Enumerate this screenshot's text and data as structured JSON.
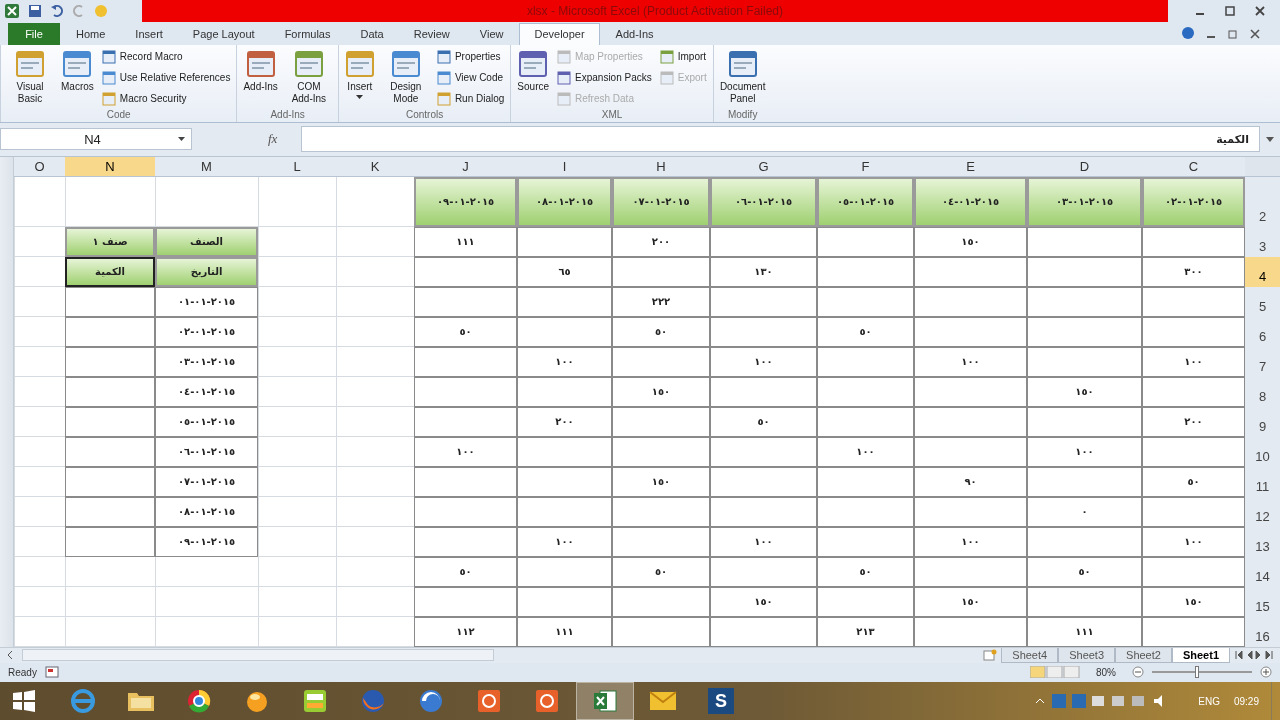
{
  "window": {
    "title": "xlsx - Microsoft Excel (Product Activation Failed)"
  },
  "ribbon_tabs": [
    {
      "label": "Add-Ins",
      "kind": "tab",
      "selected": false
    },
    {
      "label": "Developer",
      "kind": "tab",
      "selected": true
    },
    {
      "label": "View",
      "kind": "tab",
      "selected": false
    },
    {
      "label": "Review",
      "kind": "tab",
      "selected": false
    },
    {
      "label": "Data",
      "kind": "tab",
      "selected": false
    },
    {
      "label": "Formulas",
      "kind": "tab",
      "selected": false
    },
    {
      "label": "Page Layout",
      "kind": "tab",
      "selected": false
    },
    {
      "label": "Insert",
      "kind": "tab",
      "selected": false
    },
    {
      "label": "Home",
      "kind": "tab",
      "selected": false
    },
    {
      "label": "File",
      "kind": "file",
      "selected": false
    }
  ],
  "ribbon_groups": [
    {
      "label": "Modify",
      "columns": [
        {
          "items": [
            {
              "kind": "large",
              "label": "Document Panel",
              "disabled": false
            }
          ]
        }
      ]
    },
    {
      "label": "XML",
      "columns": [
        {
          "items": [
            {
              "kind": "small",
              "label": "Import",
              "disabled": false
            },
            {
              "kind": "small",
              "label": "Export",
              "disabled": true
            }
          ]
        },
        {
          "items": [
            {
              "kind": "small",
              "label": "Map Properties",
              "disabled": true
            },
            {
              "kind": "small",
              "label": "Expansion Packs",
              "disabled": false
            },
            {
              "kind": "small",
              "label": "Refresh Data",
              "disabled": true
            }
          ]
        },
        {
          "items": [
            {
              "kind": "large",
              "label": "Source",
              "disabled": false
            }
          ]
        }
      ]
    },
    {
      "label": "Controls",
      "columns": [
        {
          "items": [
            {
              "kind": "small",
              "label": "Properties",
              "disabled": false
            },
            {
              "kind": "small",
              "label": "View Code",
              "disabled": false
            },
            {
              "kind": "small",
              "label": "Run Dialog",
              "disabled": false
            }
          ]
        },
        {
          "items": [
            {
              "kind": "large",
              "label": "Design Mode",
              "disabled": false
            }
          ]
        },
        {
          "items": [
            {
              "kind": "dropdown",
              "label": "Insert",
              "disabled": false
            }
          ]
        }
      ]
    },
    {
      "label": "Add-Ins",
      "columns": [
        {
          "items": [
            {
              "kind": "large",
              "label": "COM Add-Ins",
              "disabled": false
            }
          ]
        },
        {
          "items": [
            {
              "kind": "large",
              "label": "Add-Ins",
              "disabled": false
            }
          ]
        }
      ]
    },
    {
      "label": "Code",
      "columns": [
        {
          "items": [
            {
              "kind": "small",
              "label": "Record Macro",
              "disabled": false
            },
            {
              "kind": "small",
              "label": "Use Relative References",
              "disabled": false
            },
            {
              "kind": "small",
              "label": "Macro Security",
              "disabled": false
            }
          ]
        },
        {
          "items": [
            {
              "kind": "large",
              "label": "Macros",
              "disabled": false
            }
          ]
        },
        {
          "items": [
            {
              "kind": "large",
              "label": "Visual Basic",
              "disabled": false
            }
          ]
        }
      ]
    }
  ],
  "formula_bar": {
    "name_box": "N4",
    "fx": "fx",
    "value": "الكمية"
  },
  "columns": [
    {
      "letter": "C",
      "selected": false
    },
    {
      "letter": "D",
      "selected": false
    },
    {
      "letter": "E",
      "selected": false
    },
    {
      "letter": "F",
      "selected": false
    },
    {
      "letter": "G",
      "selected": false
    },
    {
      "letter": "H",
      "selected": false
    },
    {
      "letter": "I",
      "selected": false
    },
    {
      "letter": "J",
      "selected": false
    },
    {
      "letter": "K",
      "selected": false
    },
    {
      "letter": "L",
      "selected": false
    },
    {
      "letter": "M",
      "selected": false
    },
    {
      "letter": "N",
      "selected": true
    },
    {
      "letter": "O",
      "selected": false
    }
  ],
  "rows": [
    {
      "number": "2",
      "selected": false,
      "cells": {
        "C": {
          "kind": "header",
          "text": "٢٠١٥-٠١-٠٢",
          "selected": false
        },
        "D": {
          "kind": "header",
          "text": "٢٠١٥-٠١-٠٣",
          "selected": false
        },
        "E": {
          "kind": "header",
          "text": "٢٠١٥-٠١-٠٤",
          "selected": false
        },
        "F": {
          "kind": "header",
          "text": "٢٠١٥-٠١-٠٥",
          "selected": false
        },
        "G": {
          "kind": "header",
          "text": "٢٠١٥-٠١-٠٦",
          "selected": false
        },
        "H": {
          "kind": "header",
          "text": "٢٠١٥-٠١-٠٧",
          "selected": false
        },
        "I": {
          "kind": "header",
          "text": "٢٠١٥-٠١-٠٨",
          "selected": false
        },
        "J": {
          "kind": "header",
          "text": "٢٠١٥-٠١-٠٩",
          "selected": false
        }
      }
    },
    {
      "number": "3",
      "selected": false,
      "cells": {
        "E": {
          "kind": "value",
          "text": "١٥٠",
          "selected": false
        },
        "H": {
          "kind": "value",
          "text": "٢٠٠",
          "selected": false
        },
        "J": {
          "kind": "value",
          "text": "١١١",
          "selected": false
        },
        "M": {
          "kind": "header",
          "text": "الصنف",
          "selected": false
        },
        "N": {
          "kind": "header",
          "text": "صنف ١",
          "selected": false
        }
      }
    },
    {
      "number": "4",
      "selected": true,
      "cells": {
        "C": {
          "kind": "value",
          "text": "٣٠٠",
          "selected": false
        },
        "G": {
          "kind": "value",
          "text": "١٣٠",
          "selected": false
        },
        "I": {
          "kind": "value",
          "text": "٦٥",
          "selected": false
        },
        "M": {
          "kind": "header",
          "text": "التاريخ",
          "selected": false
        },
        "N": {
          "kind": "header",
          "text": "الكمية",
          "selected": true
        }
      }
    },
    {
      "number": "5",
      "selected": false,
      "cells": {
        "H": {
          "kind": "value",
          "text": "٢٢٢",
          "selected": false
        },
        "M": {
          "kind": "value",
          "text": "٢٠١٥-٠١-٠١",
          "selected": false
        }
      }
    },
    {
      "number": "6",
      "selected": false,
      "cells": {
        "F": {
          "kind": "value",
          "text": "٥٠",
          "selected": false
        },
        "H": {
          "kind": "value",
          "text": "٥٠",
          "selected": false
        },
        "J": {
          "kind": "value",
          "text": "٥٠",
          "selected": false
        },
        "M": {
          "kind": "value",
          "text": "٢٠١٥-٠١-٠٢",
          "selected": false
        }
      }
    },
    {
      "number": "7",
      "selected": false,
      "cells": {
        "C": {
          "kind": "value",
          "text": "١٠٠",
          "selected": false
        },
        "E": {
          "kind": "value",
          "text": "١٠٠",
          "selected": false
        },
        "G": {
          "kind": "value",
          "text": "١٠٠",
          "selected": false
        },
        "I": {
          "kind": "value",
          "text": "١٠٠",
          "selected": false
        },
        "M": {
          "kind": "value",
          "text": "٢٠١٥-٠١-٠٣",
          "selected": false
        }
      }
    },
    {
      "number": "8",
      "selected": false,
      "cells": {
        "D": {
          "kind": "value",
          "text": "١٥٠",
          "selected": false
        },
        "H": {
          "kind": "value",
          "text": "١٥٠",
          "selected": false
        },
        "M": {
          "kind": "value",
          "text": "٢٠١٥-٠١-٠٤",
          "selected": false
        }
      }
    },
    {
      "number": "9",
      "selected": false,
      "cells": {
        "C": {
          "kind": "value",
          "text": "٢٠٠",
          "selected": false
        },
        "G": {
          "kind": "value",
          "text": "٥٠",
          "selected": false
        },
        "I": {
          "kind": "value",
          "text": "٢٠٠",
          "selected": false
        },
        "M": {
          "kind": "value",
          "text": "٢٠١٥-٠١-٠٥",
          "selected": false
        }
      }
    },
    {
      "number": "10",
      "selected": false,
      "cells": {
        "D": {
          "kind": "value",
          "text": "١٠٠",
          "selected": false
        },
        "F": {
          "kind": "value",
          "text": "١٠٠",
          "selected": false
        },
        "J": {
          "kind": "value",
          "text": "١٠٠",
          "selected": false
        },
        "M": {
          "kind": "value",
          "text": "٢٠١٥-٠١-٠٦",
          "selected": false
        }
      }
    },
    {
      "number": "11",
      "selected": false,
      "cells": {
        "C": {
          "kind": "value",
          "text": "٥٠",
          "selected": false
        },
        "E": {
          "kind": "value",
          "text": "٩٠",
          "selected": false
        },
        "H": {
          "kind": "value",
          "text": "١٥٠",
          "selected": false
        },
        "M": {
          "kind": "value",
          "text": "٢٠١٥-٠١-٠٧",
          "selected": false
        }
      }
    },
    {
      "number": "12",
      "selected": false,
      "cells": {
        "D": {
          "kind": "value",
          "text": "٠",
          "selected": false
        },
        "M": {
          "kind": "value",
          "text": "٢٠١٥-٠١-٠٨",
          "selected": false
        }
      }
    },
    {
      "number": "13",
      "selected": false,
      "cells": {
        "C": {
          "kind": "value",
          "text": "١٠٠",
          "selected": false
        },
        "E": {
          "kind": "value",
          "text": "١٠٠",
          "selected": false
        },
        "G": {
          "kind": "value",
          "text": "١٠٠",
          "selected": false
        },
        "I": {
          "kind": "value",
          "text": "١٠٠",
          "selected": false
        },
        "M": {
          "kind": "value",
          "text": "٢٠١٥-٠١-٠٩",
          "selected": false
        }
      }
    },
    {
      "number": "14",
      "selected": false,
      "cells": {
        "D": {
          "kind": "value",
          "text": "٥٠",
          "selected": false
        },
        "F": {
          "kind": "value",
          "text": "٥٠",
          "selected": false
        },
        "H": {
          "kind": "value",
          "text": "٥٠",
          "selected": false
        },
        "J": {
          "kind": "value",
          "text": "٥٠",
          "selected": false
        }
      }
    },
    {
      "number": "15",
      "selected": false,
      "cells": {
        "C": {
          "kind": "value",
          "text": "١٥٠",
          "selected": false
        },
        "E": {
          "kind": "value",
          "text": "١٥٠",
          "selected": false
        },
        "G": {
          "kind": "value",
          "text": "١٥٠",
          "selected": false
        }
      }
    },
    {
      "number": "16",
      "selected": false,
      "cells": {
        "D": {
          "kind": "value",
          "text": "١١١",
          "selected": false
        },
        "F": {
          "kind": "value",
          "text": "٢١٣",
          "selected": false
        },
        "I": {
          "kind": "value",
          "text": "١١١",
          "selected": false
        },
        "J": {
          "kind": "value",
          "text": "١١٢",
          "selected": false
        }
      }
    }
  ],
  "sheet_tabs": [
    {
      "label": "Sheet1",
      "selected": true
    },
    {
      "label": "Sheet2",
      "selected": false
    },
    {
      "label": "Sheet3",
      "selected": false
    },
    {
      "label": "Sheet4",
      "selected": false
    }
  ],
  "status_bar": {
    "mode": "Ready",
    "zoom": "80%",
    "zoom_slider": {
      "level": 0.45
    }
  },
  "taskbar": {
    "apps": [
      {
        "kind": "letter",
        "label": "S",
        "selected": false
      },
      {
        "kind": "mail",
        "selected": false
      },
      {
        "kind": "sheet",
        "selected": true
      },
      {
        "kind": "orange-tile",
        "selected": false
      },
      {
        "kind": "orange-tile",
        "selected": false
      },
      {
        "kind": "swirl",
        "selected": false
      },
      {
        "kind": "fox",
        "selected": false
      },
      {
        "kind": "green-tile",
        "selected": false
      },
      {
        "kind": "ball",
        "selected": false
      },
      {
        "kind": "ring",
        "selected": false
      },
      {
        "kind": "folder",
        "selected": false
      },
      {
        "kind": "browser-e",
        "selected": false
      }
    ],
    "language": "ENG",
    "time": "09:29"
  }
}
